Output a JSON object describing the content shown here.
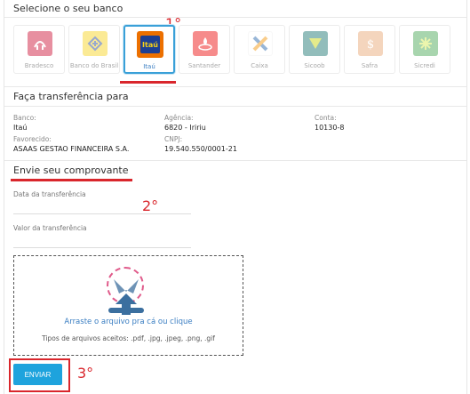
{
  "bank_section": {
    "title": "Selecione o seu banco",
    "banks": [
      {
        "name": "Bradesco",
        "color": "#cc092f",
        "selected": false
      },
      {
        "name": "Banco do Brasil",
        "color": "#f7d117",
        "selected": false
      },
      {
        "name": "Itaú",
        "color": "#ec7000",
        "selected": true
      },
      {
        "name": "Santander",
        "color": "#ec0000",
        "selected": false
      },
      {
        "name": "Caixa",
        "color": "#1c5fa8",
        "selected": false
      },
      {
        "name": "Sicoob",
        "color": "#7db61c",
        "selected": false
      },
      {
        "name": "Safra",
        "color": "#e8a36f",
        "selected": false
      },
      {
        "name": "Sicredi",
        "color": "#3fa34d",
        "selected": false
      }
    ],
    "itau_logo_text": "Itaú"
  },
  "annotations": {
    "step1": "1°",
    "step2": "2°",
    "step3": "3°"
  },
  "transfer_section": {
    "title": "Faça transferência para",
    "bank_label": "Banco:",
    "bank_value": "Itaú",
    "agency_label": "Agência:",
    "agency_value": "6820 - Iririu",
    "account_label": "Conta:",
    "account_value": "10130-8",
    "payee_label": "Favorecido:",
    "payee_value": "ASAAS GESTAO FINANCEIRA S.A.",
    "cnpj_label": "CNPJ:",
    "cnpj_value": "19.540.550/0001-21"
  },
  "receipt_section": {
    "title": "Envie seu comprovante",
    "date_label": "Data da transferência",
    "date_value": "",
    "amount_label": "Valor da transferência",
    "amount_value": "",
    "dropzone_text": "Arraste o arquivo pra cá ou clique",
    "dropzone_types": "Tipos de arquivos aceitos: .pdf, .jpg, .jpeg, .png, .gif",
    "submit_label": "ENVIAR"
  },
  "colors": {
    "accent": "#1ea3dd",
    "annotation_red": "#d9262c",
    "link": "#3a7ec2"
  }
}
